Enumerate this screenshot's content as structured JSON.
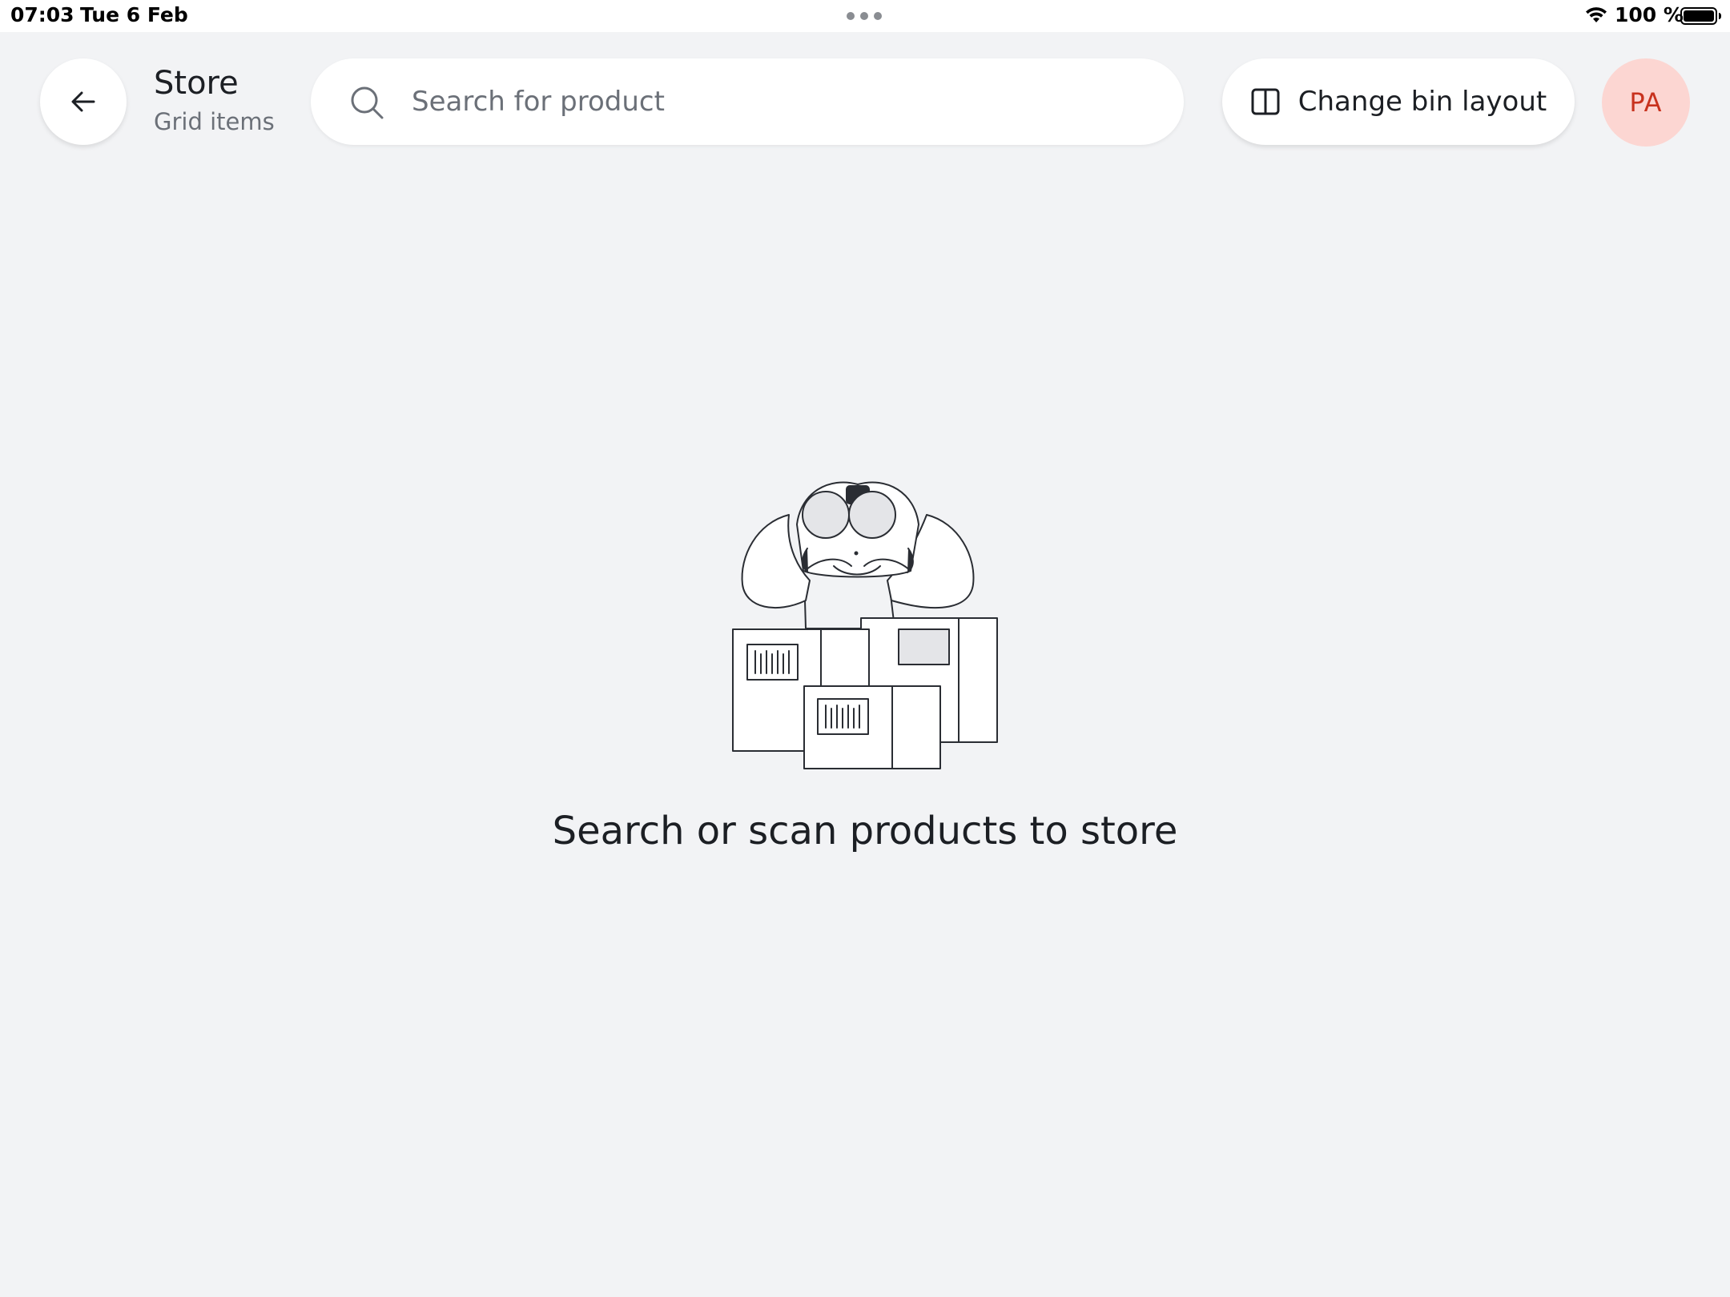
{
  "status_bar": {
    "time": "07:03",
    "date": "Tue 6 Feb",
    "battery": "100 %",
    "icons": [
      "wifi-icon",
      "battery-icon",
      "more-dots-icon"
    ]
  },
  "header": {
    "back_icon": "arrow-left-icon",
    "title": "Store",
    "subtitle": "Grid items",
    "search": {
      "placeholder": "Search for product",
      "value": "",
      "icon": "search-icon"
    },
    "layout_button": {
      "label": "Change bin layout",
      "icon": "columns-icon"
    },
    "avatar": {
      "initials": "PA",
      "background": "#fcd6d2",
      "color": "#c8321e"
    }
  },
  "empty_state": {
    "illustration": "person-with-binoculars-and-boxes",
    "message": "Search or scan products to store"
  },
  "colors": {
    "background": "#f2f3f5",
    "surface": "#ffffff",
    "text": "#1c1f24",
    "muted": "#6b7078"
  }
}
